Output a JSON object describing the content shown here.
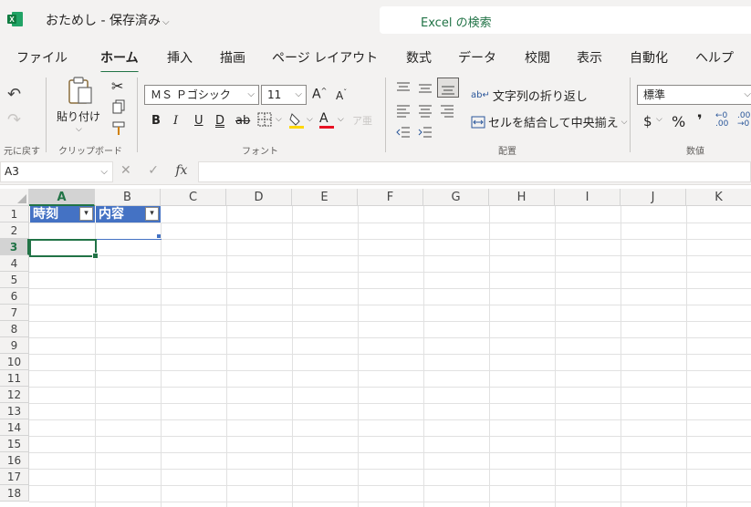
{
  "app": {
    "logo_letter": "X",
    "doc_title": "おためし - 保存済み",
    "search_placeholder": "Excel の検索"
  },
  "tabs": [
    {
      "label": "ファイル"
    },
    {
      "label": "ホーム",
      "active": true
    },
    {
      "label": "挿入"
    },
    {
      "label": "描画"
    },
    {
      "label": "ページ レイアウト"
    },
    {
      "label": "数式"
    },
    {
      "label": "データ"
    },
    {
      "label": "校閲"
    },
    {
      "label": "表示"
    },
    {
      "label": "自動化"
    },
    {
      "label": "ヘルプ"
    }
  ],
  "ribbon": {
    "undo_group": "元に戻す",
    "clipboard": {
      "paste_label": "貼り付け",
      "group": "クリップボード"
    },
    "font": {
      "name": "ＭＳ Ｐゴシック",
      "size": "11",
      "group": "フォント",
      "bold": "B",
      "italic": "I",
      "underline": "U",
      "double_underline": "D",
      "strike": "ab",
      "font_color_letter": "A",
      "font_color": "#e81123",
      "fill_color": "#ffd700"
    },
    "alignment": {
      "wrap_text": "文字列の折り返し",
      "merge_center": "セルを結合して中央揃え",
      "group": "配置"
    },
    "number": {
      "format": "標準",
      "group": "数値",
      "currency": "$",
      "percent": "%",
      "comma": "❜"
    }
  },
  "formula_bar": {
    "name_box": "A3",
    "fx": "fx",
    "value": ""
  },
  "sheet": {
    "columns": [
      "A",
      "B",
      "C",
      "D",
      "E",
      "F",
      "G",
      "H",
      "I",
      "J",
      "K"
    ],
    "rows": [
      "1",
      "2",
      "3",
      "4",
      "5",
      "6",
      "7",
      "8",
      "9",
      "10",
      "11",
      "12",
      "13",
      "14",
      "15",
      "16",
      "17",
      "18"
    ],
    "selected_column": "A",
    "selected_row": "3",
    "active_cell": "A3",
    "table_headers": [
      "時刻",
      "内容"
    ],
    "table_color": "#4472c4",
    "accent": "#217346"
  }
}
